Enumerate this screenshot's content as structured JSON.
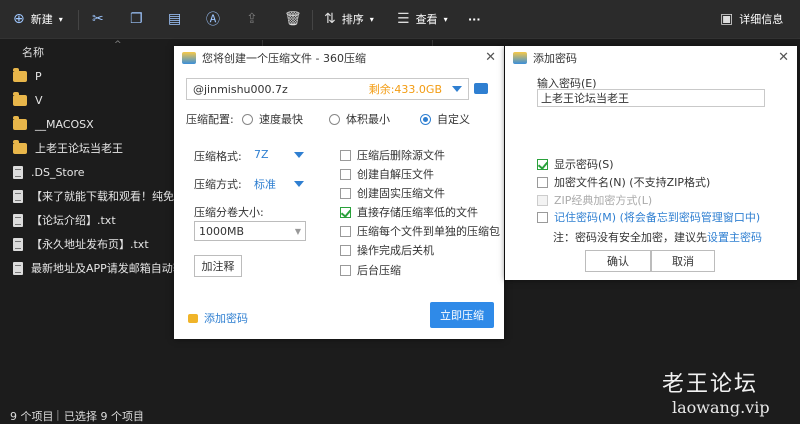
{
  "toolbar": {
    "new_label": "新建",
    "sort_label": "排序",
    "view_label": "查看",
    "more_label": "···",
    "details_label": "详细信息"
  },
  "column": {
    "name": "名称"
  },
  "files": [
    {
      "name": "P",
      "type": "folder"
    },
    {
      "name": "V",
      "type": "folder"
    },
    {
      "name": "__MACOSX",
      "type": "folder"
    },
    {
      "name": "上老王论坛当老王",
      "type": "folder"
    },
    {
      "name": ".DS_Store",
      "type": "file"
    },
    {
      "name": "【来了就能下载和观看！纯免费！",
      "type": "file"
    },
    {
      "name": "【论坛介绍】.txt",
      "type": "file"
    },
    {
      "name": "【永久地址发布页】.txt",
      "type": "file"
    },
    {
      "name": "最新地址及APP请发邮箱自动获取",
      "type": "file"
    }
  ],
  "status": {
    "count": "9 个项目",
    "selected": "已选择 9 个项目"
  },
  "compress_dialog": {
    "title": "您将创建一个压缩文件 - 360压缩",
    "path": "@jinmishu000.7z",
    "free_space": "剩余:433.0GB",
    "config_label": "压缩配置:",
    "options": [
      "速度最快",
      "体积最小",
      "自定义"
    ],
    "format_label": "压缩格式:",
    "format_value": "7Z",
    "method_label": "压缩方式:",
    "method_value": "标准",
    "split_label": "压缩分卷大小:",
    "split_value": "1000MB",
    "comment_button": "加注释",
    "checkboxes": [
      {
        "label": "压缩后删除源文件",
        "checked": false
      },
      {
        "label": "创建自解压文件",
        "checked": false
      },
      {
        "label": "创建固实压缩文件",
        "checked": false
      },
      {
        "label": "直接存储压缩率低的文件",
        "checked": true
      },
      {
        "label": "压缩每个文件到单独的压缩包",
        "checked": false
      },
      {
        "label": "操作完成后关机",
        "checked": false
      },
      {
        "label": "后台压缩",
        "checked": false
      }
    ],
    "add_password": "添加密码",
    "compress_now": "立即压缩"
  },
  "password_dialog": {
    "title": "添加密码",
    "input_label": "输入密码(E)",
    "password_value": "上老王论坛当老王",
    "show_password": "显示密码(S)",
    "encrypt_names": "加密文件名(N) (不支持ZIP格式)",
    "zip_classic": "ZIP经典加密方式(L)",
    "remember": "记住密码(M) (将会备忘到密码管理窗口中)",
    "note_prefix": "注：密码没有安全加密，建议先",
    "note_link": "设置主密码",
    "ok": "确认",
    "cancel": "取消"
  },
  "watermark": {
    "line1": "老王论坛",
    "line2": "laowang.vip"
  }
}
